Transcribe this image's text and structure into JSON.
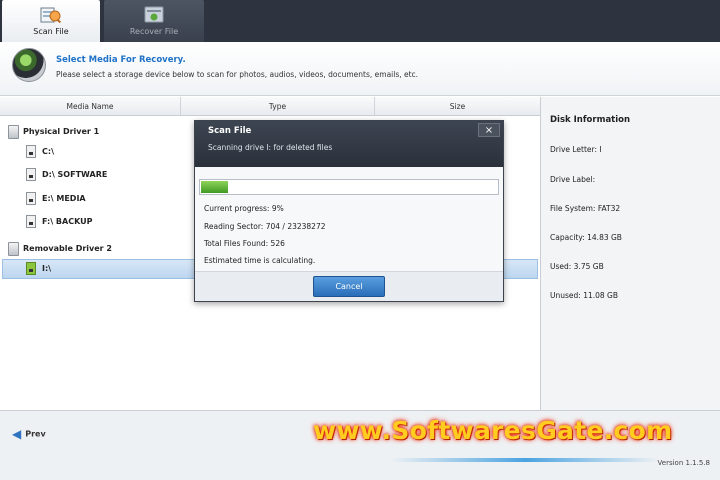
{
  "tabs": [
    {
      "label": "Scan File",
      "active": true
    },
    {
      "label": "Recover File",
      "active": false
    }
  ],
  "header": {
    "title": "Select Media For Recovery.",
    "description": "Please select a storage device below to scan for photos, audios, videos, documents, emails, etc."
  },
  "table": {
    "columns": [
      "Media Name",
      "Type",
      "Size"
    ]
  },
  "tree": {
    "groups": [
      {
        "label": "Physical Driver 1",
        "drives": [
          "C:\\",
          "D:\\ SOFTWARE",
          "E:\\ MEDIA",
          "F:\\ BACKUP"
        ]
      },
      {
        "label": "Removable Driver 2",
        "drives": [
          "I:\\"
        ]
      }
    ],
    "selected": "I:\\"
  },
  "disk_info": {
    "title": "Disk Information",
    "lines": [
      "Drive Letter: I",
      "Drive Label:",
      "File System: FAT32",
      "Capacity: 14.83 GB",
      "Used: 3.75 GB",
      "Unused: 11.08 GB"
    ]
  },
  "modal": {
    "title": "Scan File",
    "subtitle": "Scanning drive I: for deleted files",
    "close": "×",
    "progress": 0.09,
    "lines": [
      "Current progress: 9%",
      "Reading Sector: 704 / 23238272",
      "Total Files Found: 526",
      "Estimated time is calculating."
    ],
    "cancel_label": "Cancel"
  },
  "footer": {
    "prev_label": "Prev",
    "version": "Version 1.1.5.8"
  },
  "watermark": "www.SoftwaresGate.com",
  "colors": {
    "accent": "#1e72c8",
    "topbar": "#2d3440",
    "progress": "#4fae2a",
    "selection": "#c6dcf2"
  }
}
